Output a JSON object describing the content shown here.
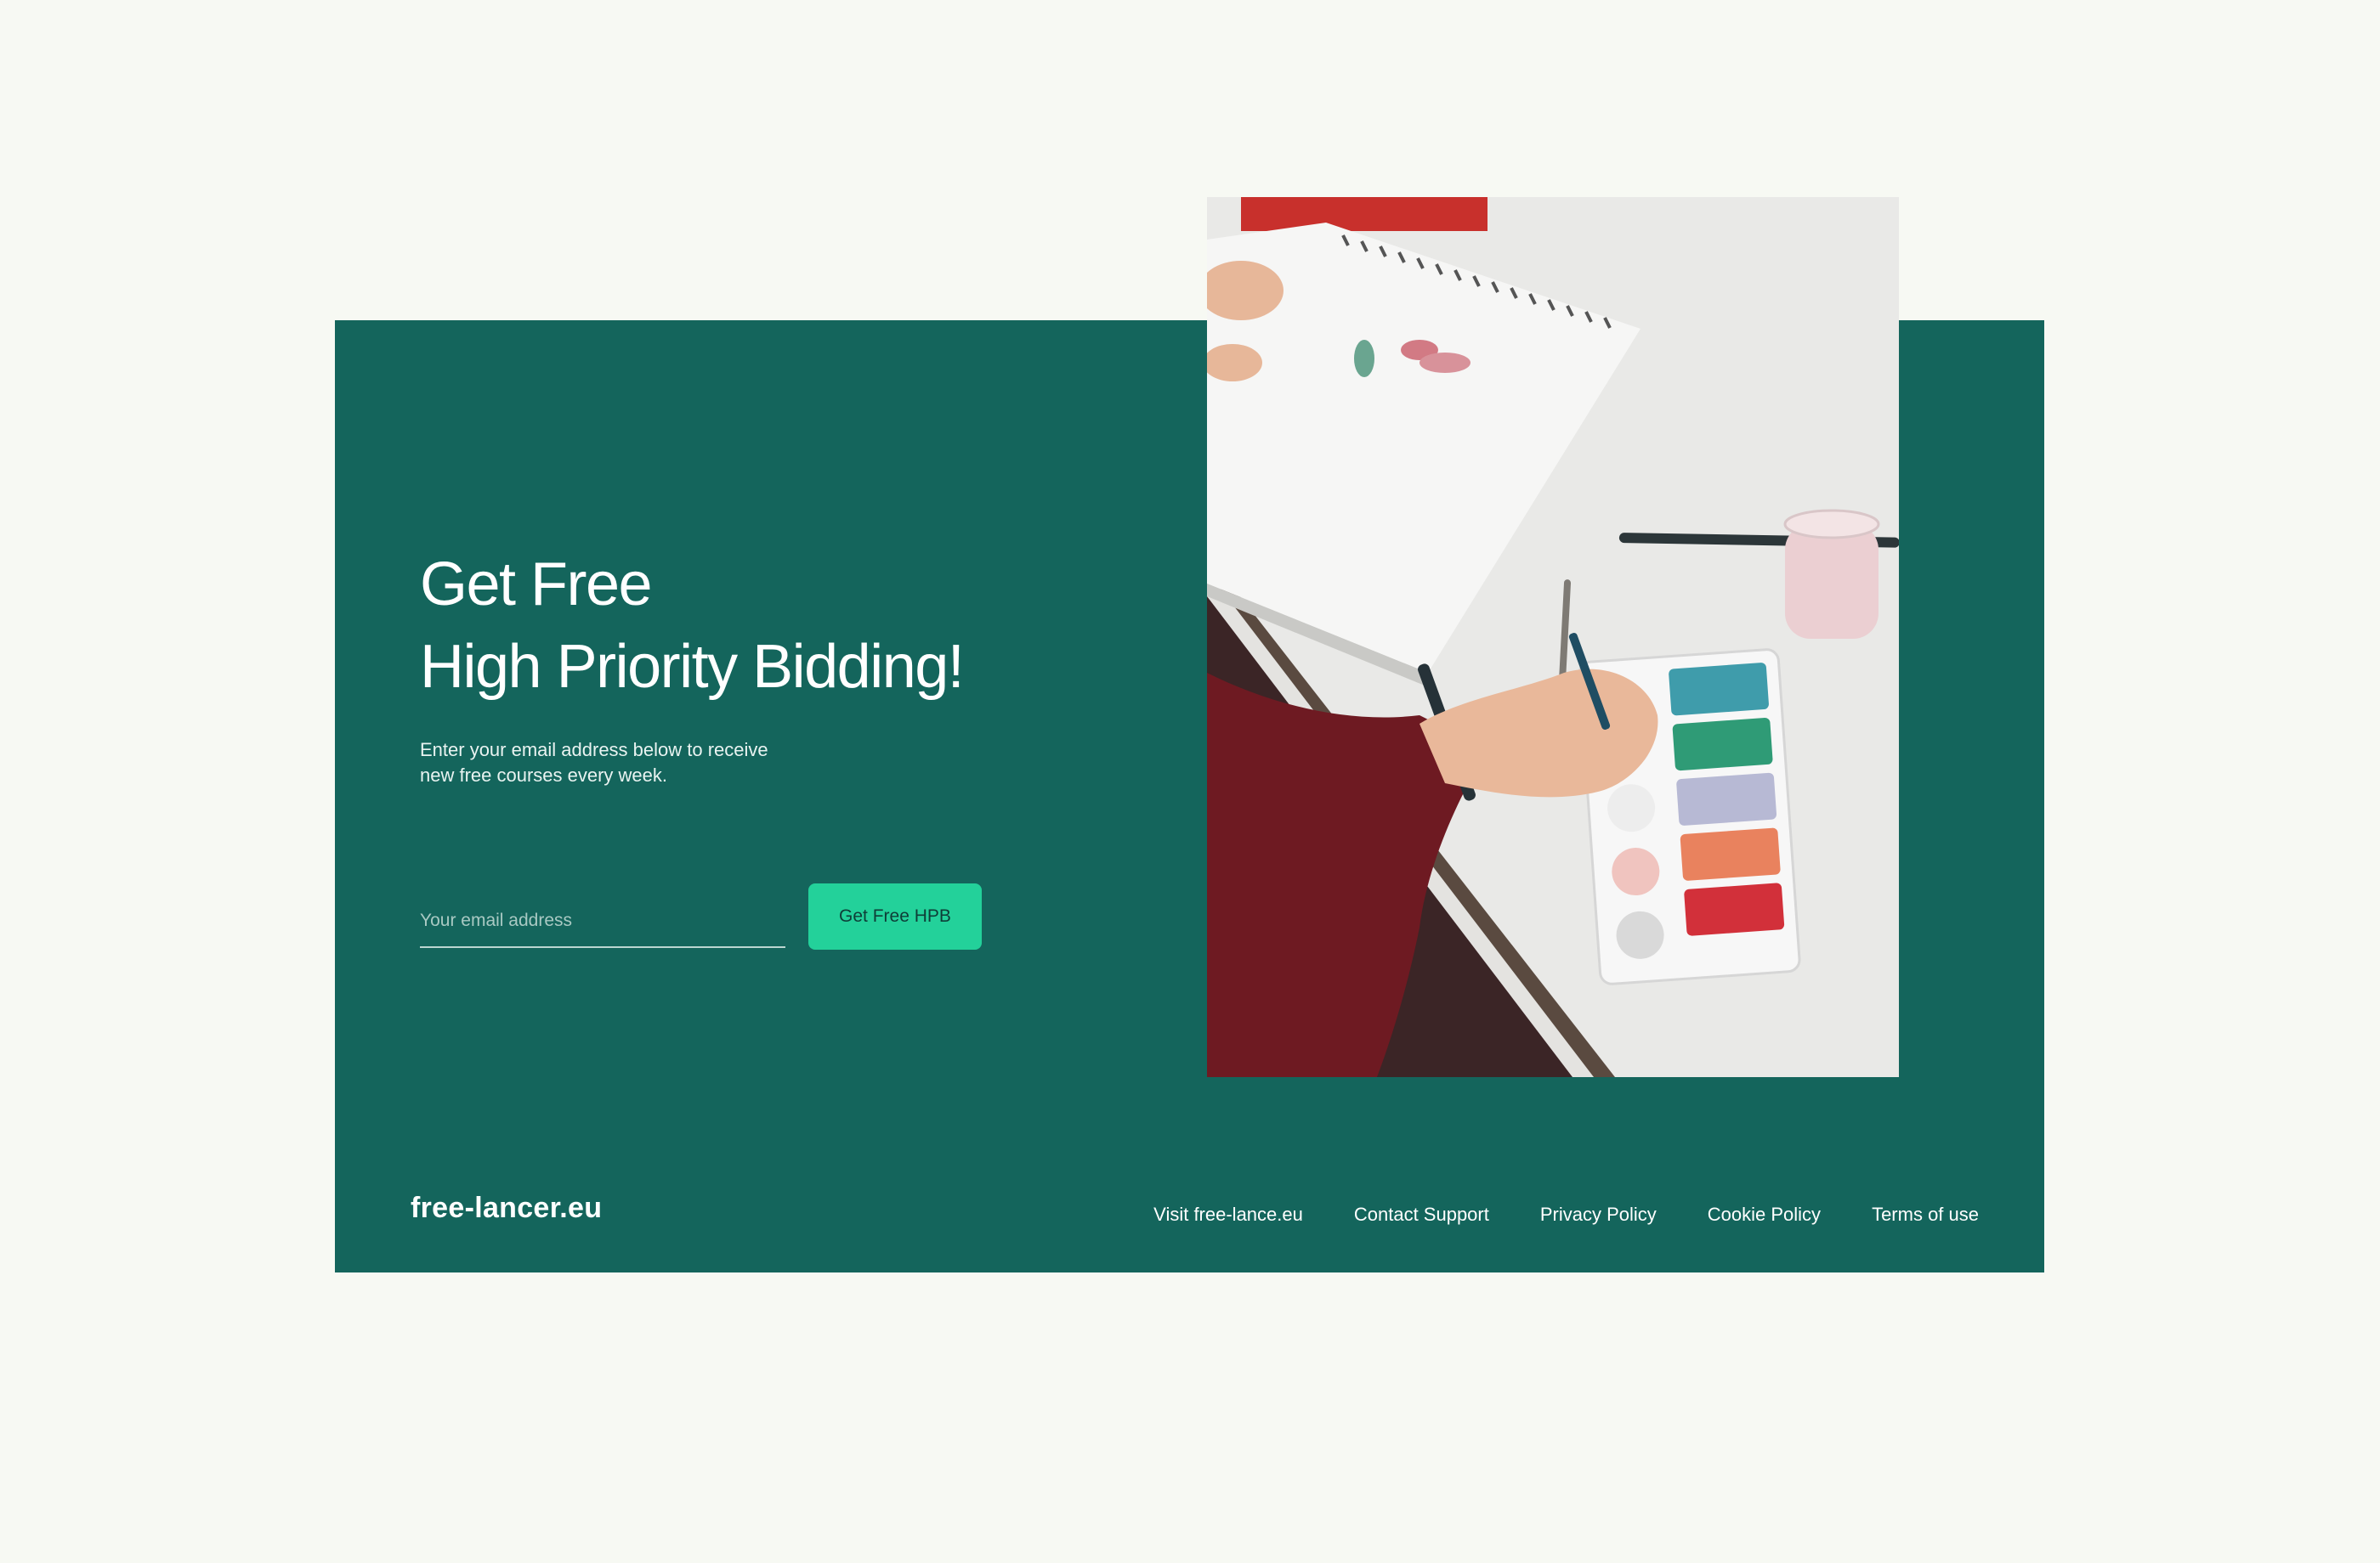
{
  "hero": {
    "headline_line1": "Get Free",
    "headline_line2": "High Priority Bidding!",
    "subtext": "Enter your email address below to receive new free courses every week.",
    "email_placeholder": "Your email address",
    "cta_label": "Get Free HPB"
  },
  "footer": {
    "logo": "free-lancer.eu",
    "links": [
      {
        "label": "Visit free-lance.eu"
      },
      {
        "label": "Contact Support"
      },
      {
        "label": "Privacy Policy"
      },
      {
        "label": "Cookie Policy"
      },
      {
        "label": "Terms of use"
      }
    ]
  },
  "colors": {
    "page_background": "#f7f9f3",
    "card_background": "#14655c",
    "cta_background": "#23d19a",
    "text_on_card": "#ffffff"
  }
}
